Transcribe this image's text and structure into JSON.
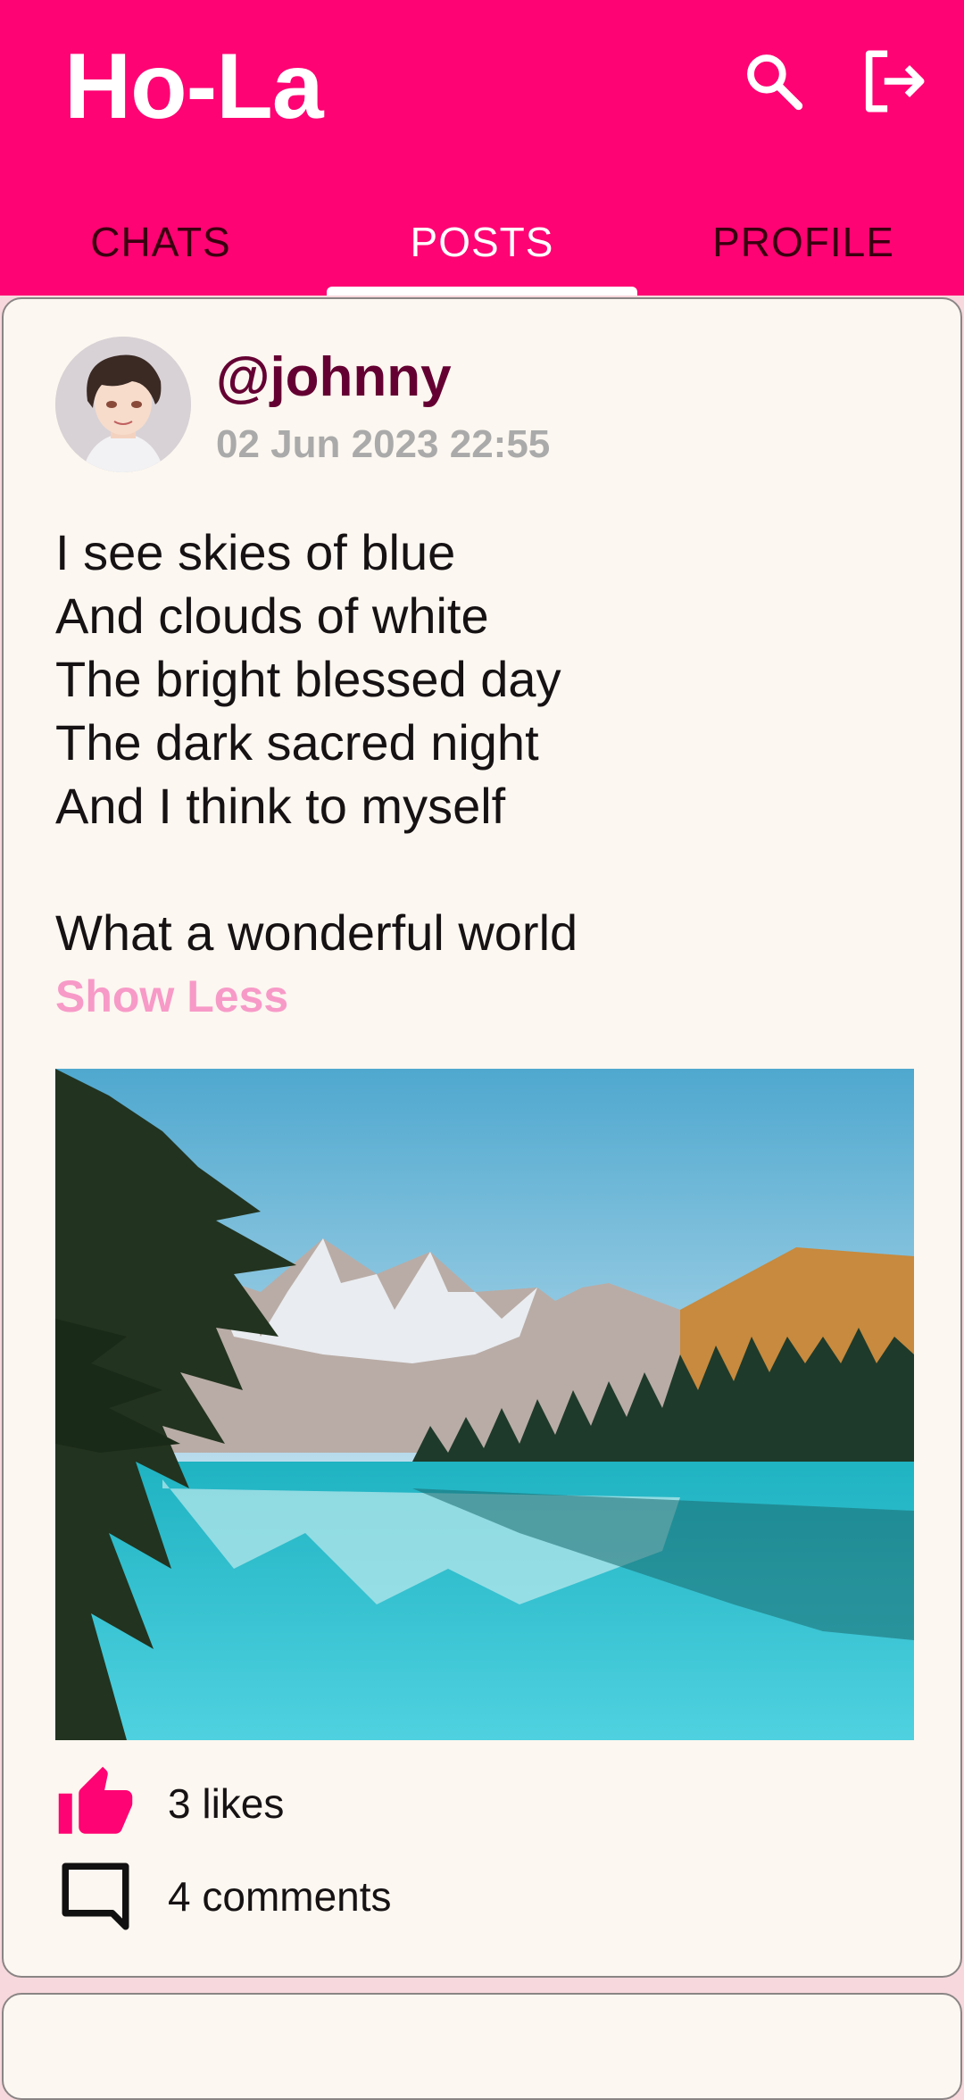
{
  "app": {
    "title": "Ho-La"
  },
  "colors": {
    "primary": "#fe0373",
    "username": "#650033",
    "link": "#f79ac8",
    "card_bg": "#fcf7f0"
  },
  "header_actions": [
    {
      "icon": "search-icon"
    },
    {
      "icon": "logout-icon"
    }
  ],
  "tabs": [
    {
      "label": "CHATS",
      "active": false
    },
    {
      "label": "POSTS",
      "active": true
    },
    {
      "label": "PROFILE",
      "active": false
    }
  ],
  "post": {
    "username": "@johnny",
    "timestamp": "02 Jun 2023 22:55",
    "body": "I see skies of blue\nAnd clouds of white\nThe bright blessed day\nThe dark sacred night\nAnd I think to myself\n\nWhat a wonderful world",
    "toggle_label": "Show Less",
    "likes_label": "3 likes",
    "comments_label": "4 comments",
    "like_icon": "thumb-up-icon",
    "comment_icon": "comment-icon"
  }
}
